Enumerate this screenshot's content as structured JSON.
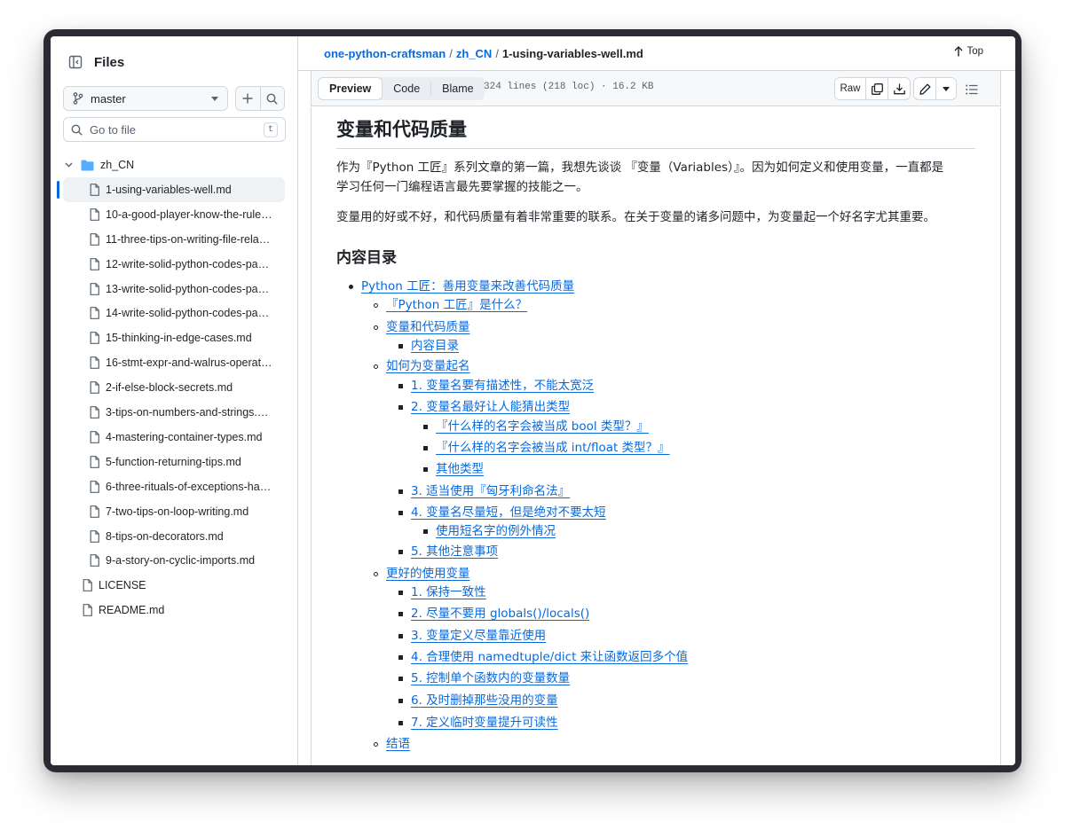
{
  "sidebar": {
    "title": "Files",
    "branch": "master",
    "goto_placeholder": "Go to file",
    "goto_shortcut": "t",
    "folder": "zh_CN",
    "files": [
      "1-using-variables-well.md",
      "10-a-good-player-know-the-rule…",
      "11-three-tips-on-writing-file-rela…",
      "12-write-solid-python-codes-pa…",
      "13-write-solid-python-codes-pa…",
      "14-write-solid-python-codes-pa…",
      "15-thinking-in-edge-cases.md",
      "16-stmt-expr-and-walrus-operat…",
      "2-if-else-block-secrets.md",
      "3-tips-on-numbers-and-strings.…",
      "4-mastering-container-types.md",
      "5-function-returning-tips.md",
      "6-three-rituals-of-exceptions-ha…",
      "7-two-tips-on-loop-writing.md",
      "8-tips-on-decorators.md",
      "9-a-story-on-cyclic-imports.md"
    ],
    "root_files": [
      "LICENSE",
      "README.md"
    ]
  },
  "breadcrumb": {
    "repo": "one-python-craftsman",
    "folder": "zh_CN",
    "file": "1-using-variables-well.md",
    "top_label": "Top"
  },
  "toolbar": {
    "tab_preview": "Preview",
    "tab_code": "Code",
    "tab_blame": "Blame",
    "file_info": "324 lines (218 loc) · 16.2 KB",
    "raw_label": "Raw"
  },
  "doc": {
    "title": "变量和代码质量",
    "para1_line1": "作为『Python 工匠』系列文章的第一篇，我想先谈谈 『变量（Variables）』。因为如何定义和使用变量，一直都是",
    "para1_line2": "学习任何一门编程语言最先要掌握的技能之一。",
    "para2": "变量用的好或不好，和代码质量有着非常重要的联系。在关于变量的诸多问题中，为变量起一个好名字尤其重要。",
    "toc_heading": "内容目录",
    "toc": [
      {
        "level": 1,
        "text": "Python 工匠：善用变量来改善代码质量"
      },
      {
        "level": 2,
        "text": "『Python 工匠』是什么？"
      },
      {
        "level": 2,
        "text": "变量和代码质量"
      },
      {
        "level": 3,
        "text": "内容目录"
      },
      {
        "level": 2,
        "text": "如何为变量起名"
      },
      {
        "level": 3,
        "text": "1. 变量名要有描述性，不能太宽泛"
      },
      {
        "level": 3,
        "text": "2. 变量名最好让人能猜出类型"
      },
      {
        "level": 4,
        "text": "『什么样的名字会被当成 bool 类型？』"
      },
      {
        "level": 4,
        "text": "『什么样的名字会被当成 int/float 类型？』"
      },
      {
        "level": 4,
        "text": "其他类型"
      },
      {
        "level": 3,
        "text": "3. 适当使用『匈牙利命名法』"
      },
      {
        "level": 3,
        "text": "4. 变量名尽量短，但是绝对不要太短"
      },
      {
        "level": 4,
        "text": "使用短名字的例外情况"
      },
      {
        "level": 3,
        "text": "5. 其他注意事项"
      },
      {
        "level": 2,
        "text": "更好的使用变量"
      },
      {
        "level": 3,
        "text": "1. 保持一致性"
      },
      {
        "level": 3,
        "text": "2. 尽量不要用 globals()/locals()"
      },
      {
        "level": 3,
        "text": "3. 变量定义尽量靠近使用"
      },
      {
        "level": 3,
        "text": "4. 合理使用 namedtuple/dict 来让函数返回多个值"
      },
      {
        "level": 3,
        "text": "5. 控制单个函数内的变量数量"
      },
      {
        "level": 3,
        "text": "6. 及时删掉那些没用的变量"
      },
      {
        "level": 3,
        "text": "7. 定义临时变量提升可读性"
      },
      {
        "level": 2,
        "text": "结语"
      }
    ]
  }
}
